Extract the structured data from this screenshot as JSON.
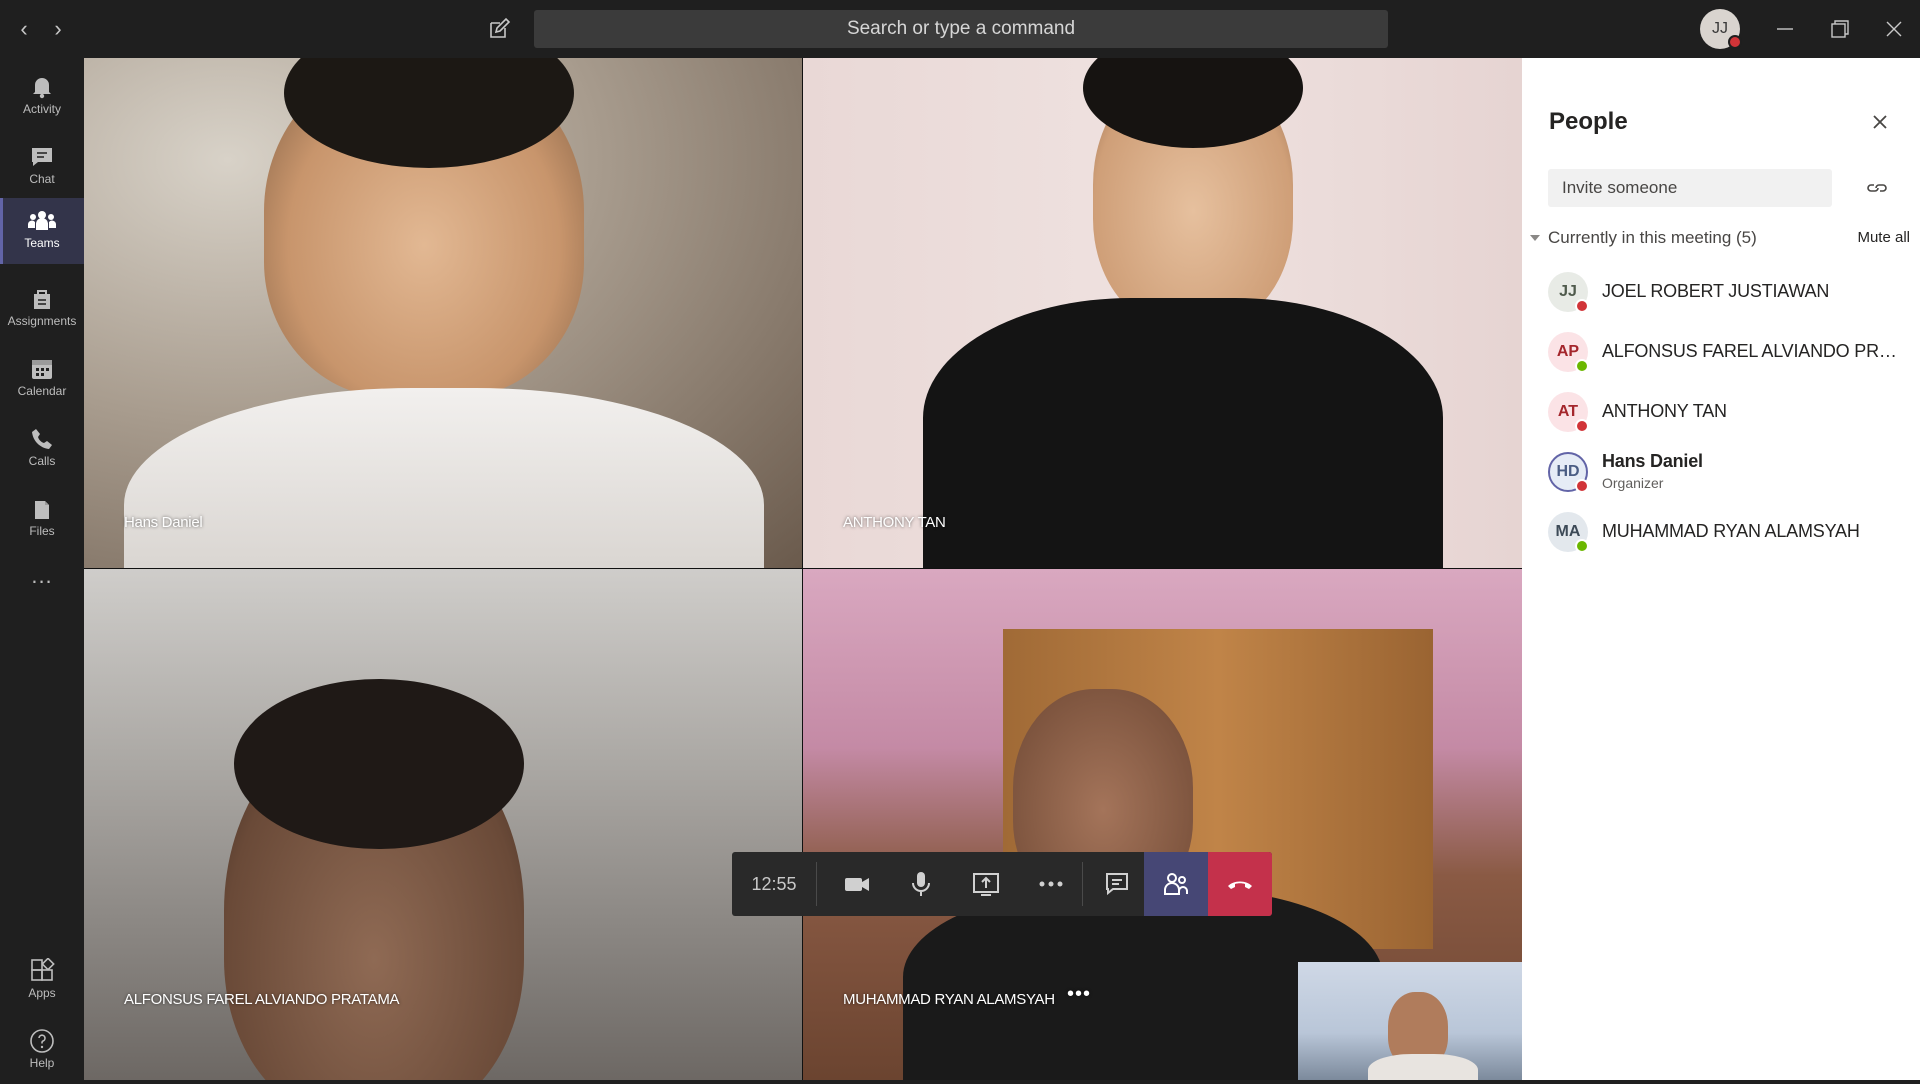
{
  "titlebar": {
    "search_placeholder": "Search or type a command",
    "user_initials": "JJ"
  },
  "rail": {
    "items": [
      {
        "label": "Activity",
        "icon": "bell-icon"
      },
      {
        "label": "Chat",
        "icon": "chat-icon"
      },
      {
        "label": "Teams",
        "icon": "teams-icon",
        "active": true
      },
      {
        "label": "Assignments",
        "icon": "assignments-icon"
      },
      {
        "label": "Calendar",
        "icon": "calendar-icon"
      },
      {
        "label": "Calls",
        "icon": "phone-icon"
      },
      {
        "label": "Files",
        "icon": "files-icon"
      }
    ],
    "more": "...",
    "apps_label": "Apps",
    "help_label": "Help"
  },
  "tiles": [
    {
      "name": "Hans Daniel"
    },
    {
      "name": "ANTHONY TAN"
    },
    {
      "name": "ALFONSUS FAREL ALVIANDO PRATAMA"
    },
    {
      "name": "MUHAMMAD RYAN ALAMSYAH"
    }
  ],
  "callbar": {
    "duration": "12:55"
  },
  "people_panel": {
    "title": "People",
    "invite_placeholder": "Invite someone",
    "section_label": "Currently in this meeting (5)",
    "mute_all": "Mute all",
    "participants": [
      {
        "initials": "JJ",
        "name": "JOEL ROBERT JUSTIAWAN",
        "status": "busy",
        "bg": "#e8ebe6",
        "fg": "#4f5a4c"
      },
      {
        "initials": "AP",
        "name": "ALFONSUS FAREL ALVIANDO PRA...",
        "status": "available",
        "bg": "#fbe3e6",
        "fg": "#a4262c"
      },
      {
        "initials": "AT",
        "name": "ANTHONY TAN",
        "status": "busy",
        "bg": "#fbe3e6",
        "fg": "#a4262c"
      },
      {
        "initials": "HD",
        "name": "Hans Daniel",
        "role": "Organizer",
        "status": "busy",
        "bg": "#e6ecf6",
        "fg": "#4b5d84"
      },
      {
        "initials": "MA",
        "name": "MUHAMMAD RYAN ALAMSYAH",
        "status": "available",
        "bg": "#e3e8ed",
        "fg": "#3d4a57"
      }
    ]
  },
  "colors": {
    "accent": "#6264a7",
    "hangup": "#c4314b",
    "busy": "#d13438",
    "available": "#6bb700"
  }
}
